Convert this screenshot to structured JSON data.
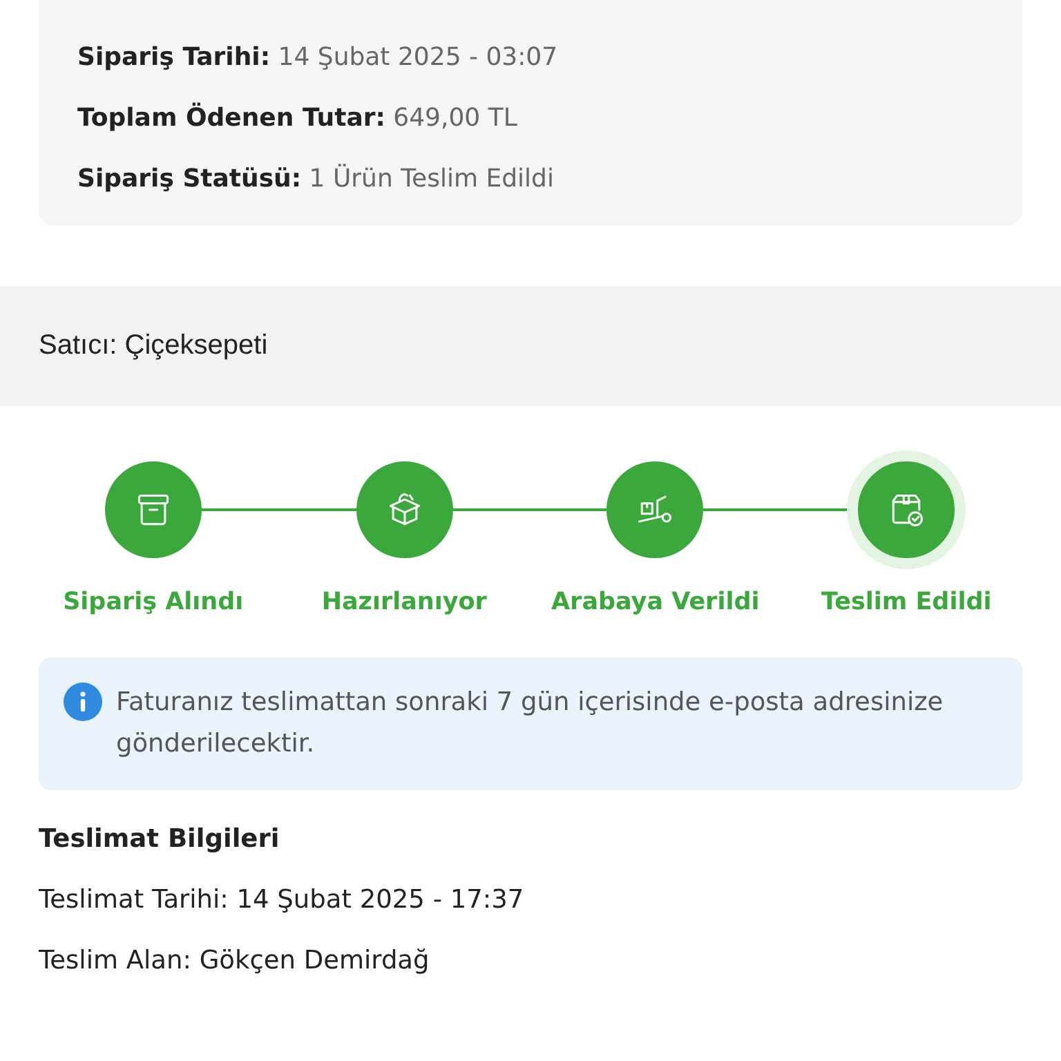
{
  "order_summary": {
    "rows": [
      {
        "label": "Sipariş Tarihi:",
        "value": "14 Şubat 2025 - 03:07"
      },
      {
        "label": "Toplam Ödenen Tutar:",
        "value": "649,00 TL"
      },
      {
        "label": "Sipariş Statüsü:",
        "value": "1 Ürün Teslim Edildi"
      }
    ]
  },
  "seller": {
    "label": "Satıcı:",
    "name": "Çiçeksepeti"
  },
  "steps": [
    {
      "label": "Sipariş Alındı",
      "kind": "received",
      "completed": true,
      "current": false
    },
    {
      "label": "Hazırlanıyor",
      "kind": "preparing",
      "completed": true,
      "current": false
    },
    {
      "label": "Arabaya Verildi",
      "kind": "shipped",
      "completed": true,
      "current": false
    },
    {
      "label": "Teslim Edildi",
      "kind": "delivered",
      "completed": true,
      "current": true
    }
  ],
  "info": {
    "text": "Faturanız teslimattan sonraki 7 gün içerisinde e-posta adresinize gönderilecektir."
  },
  "delivery": {
    "title": "Teslimat Bilgileri",
    "rows": [
      {
        "label": "Teslimat Tarihi:",
        "value": "14 Şubat 2025 - 17:37"
      },
      {
        "label": "Teslim Alan:",
        "value": "Gökçen Demirdağ"
      }
    ]
  }
}
